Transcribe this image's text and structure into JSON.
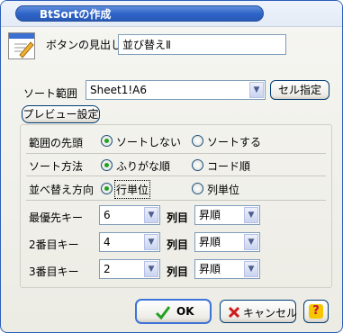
{
  "window": {
    "title": "BtSortの作成"
  },
  "caption": {
    "label": "ボタンの見出し",
    "value": "並び替えⅡ"
  },
  "range": {
    "label": "ソート範囲",
    "value": "Sheet1!A6",
    "select_button": "セル指定",
    "preview_button": "プレビュー設定"
  },
  "options": {
    "header": {
      "label": "範囲の先頭",
      "opt1": "ソートしない",
      "opt2": "ソートする",
      "selected": 1
    },
    "method": {
      "label": "ソート方法",
      "opt1": "ふりがな順",
      "opt2": "コード順",
      "selected": 1
    },
    "direction": {
      "label": "並べ替え方向",
      "opt1": "行単位",
      "opt2": "列単位",
      "selected": 1
    }
  },
  "keys": [
    {
      "label": "最優先キー",
      "column": "6",
      "unit": "列目",
      "order": "昇順"
    },
    {
      "label": "2番目キー",
      "column": "4",
      "unit": "列目",
      "order": "昇順"
    },
    {
      "label": "3番目キー",
      "column": "2",
      "unit": "列目",
      "order": "昇順"
    }
  ],
  "buttons": {
    "ok": "OK",
    "cancel": "キャンセル",
    "help": "?"
  },
  "colors": {
    "accent": "#2d62c7",
    "check": "#21a121",
    "cancel_x": "#d11a1a",
    "help_bg": "#f6c700"
  }
}
